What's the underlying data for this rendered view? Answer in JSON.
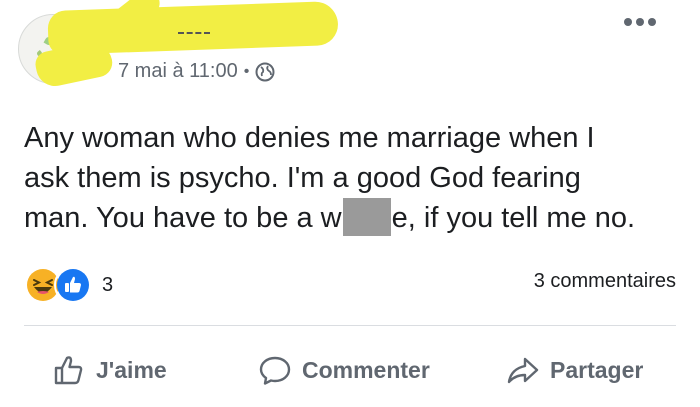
{
  "post": {
    "timestamp": "7 mai à 11:00",
    "separator": "•",
    "privacy_icon": "globe-icon",
    "text_lines": [
      "Any woman who denies me marriage when I",
      "ask them is psycho. I'm a good God fearing",
      "man. You have to be a w"
    ],
    "text_after_censor": "e, if you tell me no.",
    "reactions": {
      "icons": [
        "haha-icon",
        "like-icon"
      ],
      "count": "3"
    },
    "comments_label": "3 commentaires"
  },
  "actions": {
    "like_label": "J'aime",
    "comment_label": "Commenter",
    "share_label": "Partager"
  },
  "colors": {
    "text": "#1c1e21",
    "secondary": "#606770",
    "like_blue": "#1877f2",
    "haha_yellow": "#f7b125",
    "redaction_yellow": "#f2ee44",
    "censor_gray": "#9a9a9a"
  }
}
